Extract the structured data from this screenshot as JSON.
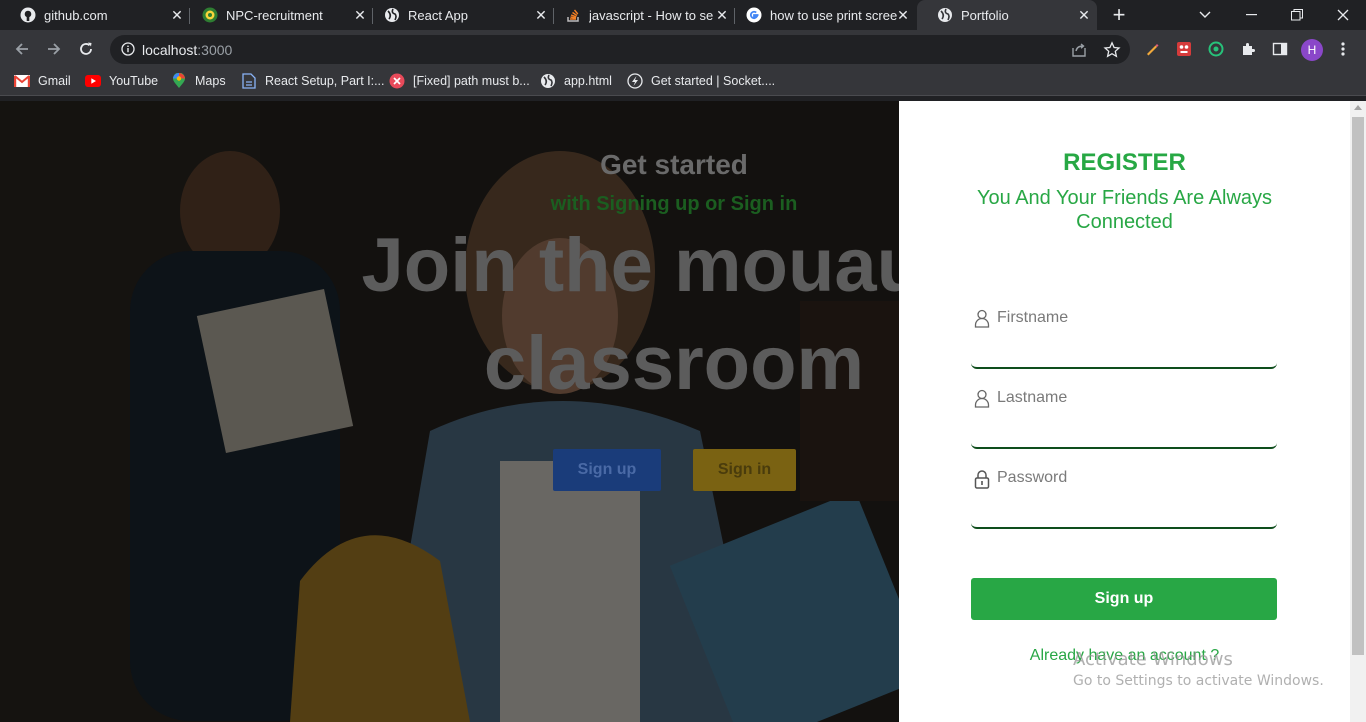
{
  "browser": {
    "tabs": [
      {
        "title": "github.com",
        "icon": "github-icon"
      },
      {
        "title": "NPC-recruitment",
        "icon": "npc-icon"
      },
      {
        "title": "React App",
        "icon": "globe-icon"
      },
      {
        "title": "javascript - How to se",
        "icon": "stackoverflow-icon"
      },
      {
        "title": "how to use print scree",
        "icon": "google-icon"
      },
      {
        "title": "Portfolio",
        "icon": "globe-icon",
        "active": true
      }
    ],
    "url": {
      "host": "localhost",
      "port": ":3000"
    },
    "profile_initial": "H",
    "bookmarks": [
      {
        "label": "Gmail",
        "icon": "gmail-icon"
      },
      {
        "label": "YouTube",
        "icon": "youtube-icon"
      },
      {
        "label": "Maps",
        "icon": "maps-icon"
      },
      {
        "label": "React Setup, Part I:...",
        "icon": "page-icon"
      },
      {
        "label": "[Fixed] path must b...",
        "icon": "error-icon"
      },
      {
        "label": "app.html",
        "icon": "globe-icon"
      },
      {
        "label": "Get started | Socket....",
        "icon": "socket-icon"
      }
    ]
  },
  "hero": {
    "get_started": "Get started",
    "with_signing": "with Signing up or Sign in",
    "headline_line1": "Join the mouau v",
    "headline_line2": "classroom",
    "signup_label": "Sign up",
    "signin_label": "Sign in"
  },
  "register": {
    "title": "REGISTER",
    "subtitle": "You And Your Friends Are Always Connected",
    "firstname_placeholder": "Firstname",
    "lastname_placeholder": "Lastname",
    "password_placeholder": "Password",
    "submit_label": "Sign up",
    "already_label": "Already have an account ?"
  },
  "watermark": {
    "line1": "Activate Windows",
    "line2": "Go to Settings to activate Windows."
  },
  "colors": {
    "accent_green": "#28a745",
    "dark_green": "#0e4d1c",
    "chrome_dark": "#202124",
    "chrome_toolbar": "#35363a"
  }
}
